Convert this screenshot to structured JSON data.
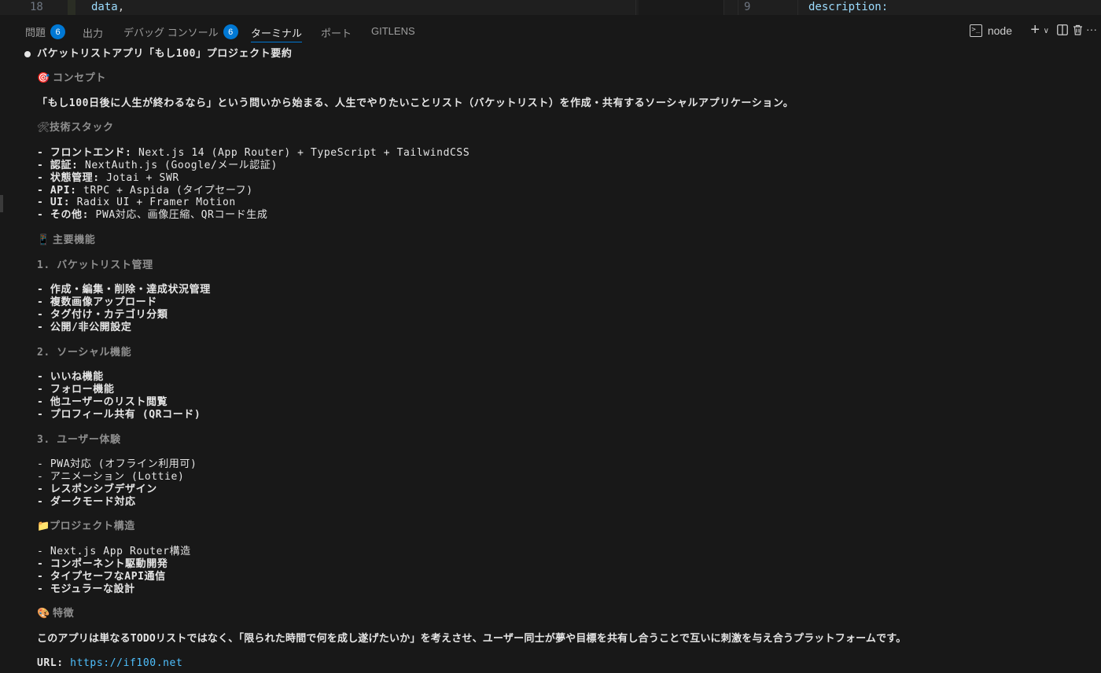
{
  "editor": {
    "left_line_number": "18",
    "left_code": "data",
    "left_code_punct": ",",
    "right_line_number": "9",
    "right_code": "description:"
  },
  "panel_tabs": [
    {
      "label": "問題",
      "badge": "6"
    },
    {
      "label": "出力"
    },
    {
      "label": "デバッグ コンソール",
      "badge": "6"
    },
    {
      "label": "ターミナル",
      "active": true
    },
    {
      "label": "ポート"
    },
    {
      "label": "GITLENS"
    }
  ],
  "terminal_tools": {
    "shell_label": "node"
  },
  "icons": {
    "concept": "🎯",
    "stack": "🛠",
    "features": "📱",
    "structure": "📁",
    "traits": "🎨"
  },
  "summary": {
    "title": "バケットリストアプリ「もし100」プロジェクト要約",
    "concept_heading": "コンセプト",
    "concept_text": "「もし100日後に人生が終わるなら」という問いから始まる、人生でやりたいことリスト（バケットリスト）を作成・共有するソーシャルアプリケーション。",
    "stack_heading": "技術スタック",
    "stack_items": [
      {
        "label": "フロントエンド:",
        "value": "Next.js 14 (App Router) + TypeScript + TailwindCSS"
      },
      {
        "label": "認証:",
        "value": "NextAuth.js (Google/メール認証)"
      },
      {
        "label": "状態管理:",
        "value": "Jotai + SWR"
      },
      {
        "label": "API:",
        "value": "tRPC + Aspida (タイプセーフ)"
      },
      {
        "label": "UI:",
        "value": "Radix UI + Framer Motion"
      },
      {
        "label": "その他:",
        "value": "PWA対応、画像圧縮、QRコード生成"
      }
    ],
    "features_heading": "主要機能",
    "feature_groups": [
      {
        "heading": "1. バケットリスト管理",
        "items": [
          "作成・編集・削除・達成状況管理",
          "複数画像アップロード",
          "タグ付け・カテゴリ分類",
          "公開/非公開設定"
        ]
      },
      {
        "heading": "2. ソーシャル機能",
        "items": [
          "いいね機能",
          "フォロー機能",
          "他ユーザーのリスト閲覧",
          "プロフィール共有 (QRコード)"
        ]
      },
      {
        "heading": "3. ユーザー体験",
        "items": [
          "PWA対応 (オフライン利用可)",
          "アニメーション (Lottie)",
          "レスポンシブデザイン",
          "ダークモード対応"
        ]
      }
    ],
    "structure_heading": "プロジェクト構造",
    "structure_items": [
      "Next.js App Router構造",
      "コンポーネント駆動開発",
      "タイプセーフなAPI通信",
      "モジュラーな設計"
    ],
    "traits_heading": "特徴",
    "traits_text": "このアプリは単なるTODOリストではなく、「限られた時間で何を成し遂げたいか」を考えさせ、ユーザー同士が夢や目標を共有し合うことで互いに刺激を与え合うプラットフォームです。",
    "url_label": "URL:",
    "url": "https://if100.net"
  }
}
